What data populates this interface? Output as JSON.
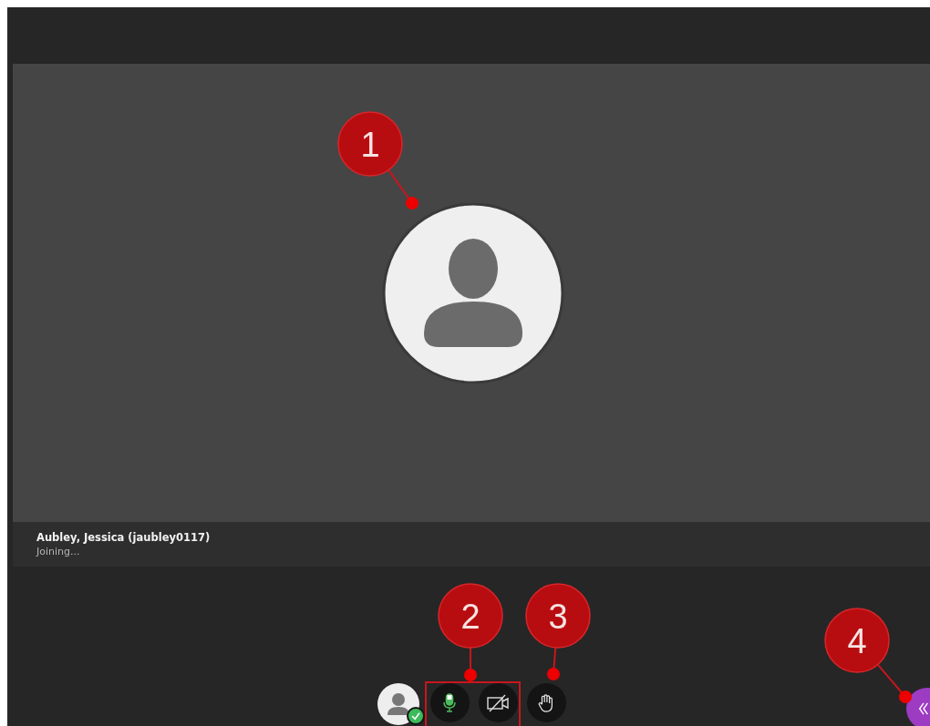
{
  "participant": {
    "name": "Aubley, Jessica (jaubley0117)",
    "status": "Joining..."
  },
  "controls": [
    {
      "kind": "avatar",
      "available": true
    },
    {
      "kind": "microphone",
      "on": true
    },
    {
      "kind": "camera",
      "on": false
    },
    {
      "kind": "hand",
      "on": false
    }
  ],
  "callouts": [
    {
      "label": "1"
    },
    {
      "label": "2"
    },
    {
      "label": "3"
    },
    {
      "label": "4"
    }
  ]
}
